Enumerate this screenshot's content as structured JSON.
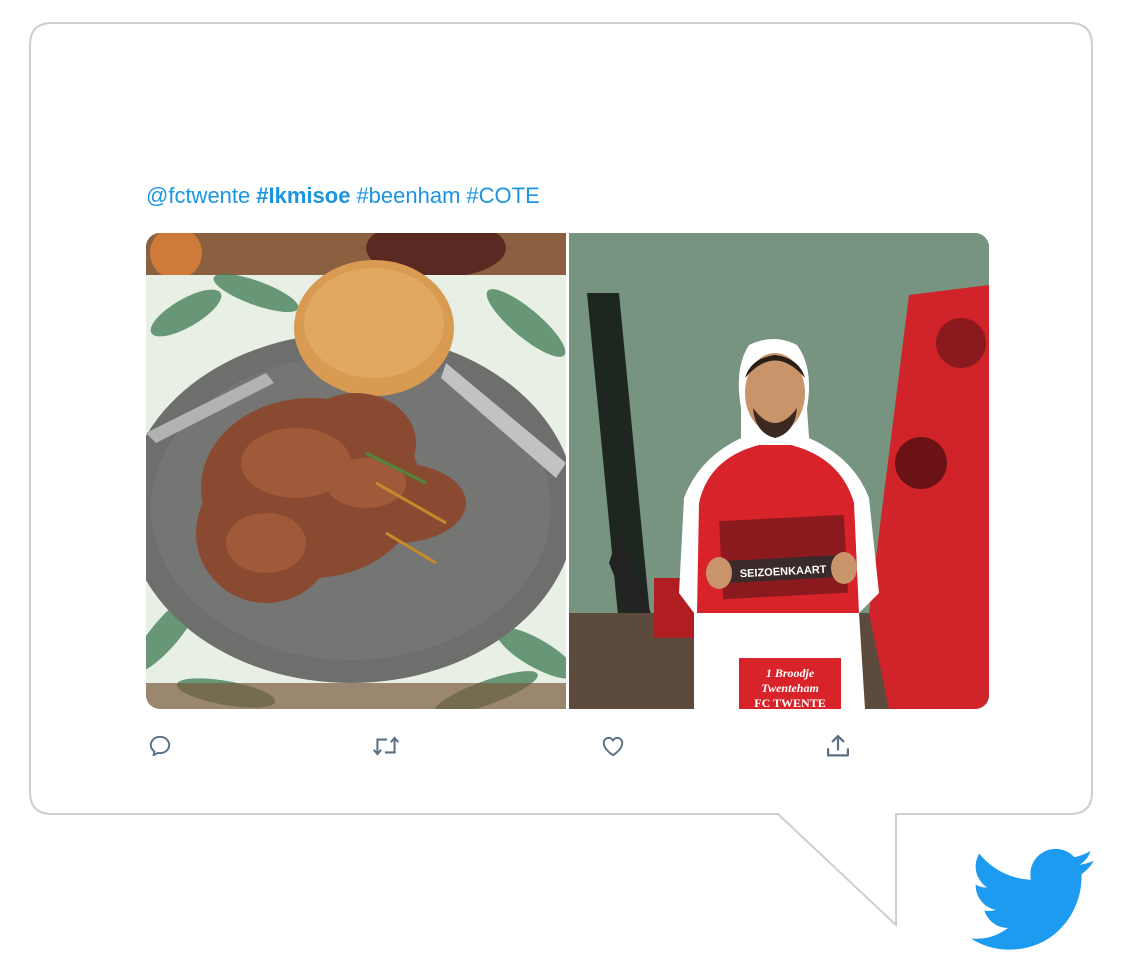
{
  "tweet": {
    "mention": "@fctwente",
    "hashtags": [
      "#Ikmisoe",
      "#beenham",
      "#COTE"
    ]
  },
  "media": {
    "left_photo": {
      "description_icon": "food-plate-photo"
    },
    "right_photo": {
      "description_icon": "player-cutout-photo",
      "card_label": "SEIZOENKAART",
      "sign_line1": "1 Broodje",
      "sign_line2": "Twenteham",
      "sign_line3": "FC TWENTE"
    }
  },
  "actions": {
    "reply_icon": "reply-icon",
    "retweet_icon": "retweet-icon",
    "like_icon": "like-icon",
    "share_icon": "share-icon"
  },
  "colors": {
    "link": "#1b95e0",
    "twitter_blue": "#1d9bf0",
    "icon_gray": "#5b7083",
    "bubble_border": "#cfcfcf"
  }
}
